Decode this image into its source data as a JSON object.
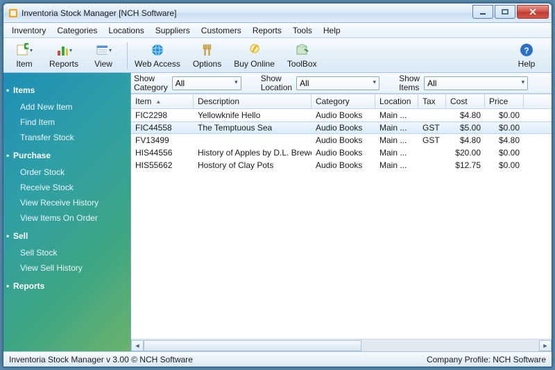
{
  "window": {
    "title": "Inventoria Stock Manager [NCH Software]"
  },
  "menubar": [
    "Inventory",
    "Categories",
    "Locations",
    "Suppliers",
    "Customers",
    "Reports",
    "Tools",
    "Help"
  ],
  "toolbar": [
    {
      "id": "item",
      "label": "Item",
      "drop": true,
      "icon": "plus"
    },
    {
      "id": "reports",
      "label": "Reports",
      "drop": true,
      "icon": "bars"
    },
    {
      "id": "view",
      "label": "View",
      "drop": true,
      "icon": "eye"
    },
    {
      "id": "sep"
    },
    {
      "id": "web",
      "label": "Web Access",
      "icon": "globe"
    },
    {
      "id": "options",
      "label": "Options",
      "icon": "wrench"
    },
    {
      "id": "buy",
      "label": "Buy Online",
      "icon": "cart"
    },
    {
      "id": "toolbox",
      "label": "ToolBox",
      "icon": "box"
    }
  ],
  "help_label": "Help",
  "filters": {
    "category_label": "Show\nCategory",
    "category_value": "All",
    "location_label": "Show\nLocation",
    "location_value": "All",
    "items_label": "Show\nItems",
    "items_value": "All"
  },
  "columns": [
    {
      "key": "item",
      "label": "Item",
      "cls": "c-item",
      "sorted": true
    },
    {
      "key": "desc",
      "label": "Description",
      "cls": "c-desc"
    },
    {
      "key": "cat",
      "label": "Category",
      "cls": "c-cat"
    },
    {
      "key": "loc",
      "label": "Location",
      "cls": "c-loc"
    },
    {
      "key": "tax",
      "label": "Tax",
      "cls": "c-tax"
    },
    {
      "key": "cost",
      "label": "Cost",
      "cls": "c-cost",
      "num": true
    },
    {
      "key": "price",
      "label": "Price",
      "cls": "c-price",
      "num": true
    }
  ],
  "rows": [
    {
      "item": "FIC2298",
      "desc": "Yellowknife Hello",
      "cat": "Audio Books",
      "loc": "Main ...",
      "tax": "",
      "cost": "$4.80",
      "price": "$0.00",
      "selected": false
    },
    {
      "item": "FIC44558",
      "desc": "The Temptuous Sea",
      "cat": "Audio Books",
      "loc": "Main ...",
      "tax": "GST",
      "cost": "$5.00",
      "price": "$0.00",
      "selected": true
    },
    {
      "item": "FV13499",
      "desc": "",
      "cat": "Audio Books",
      "loc": "Main ...",
      "tax": "GST",
      "cost": "$4.80",
      "price": "$4.80",
      "selected": false
    },
    {
      "item": "HIS44556",
      "desc": "History of Apples by D.L. Brewer",
      "cat": "Audio Books",
      "loc": "Main ...",
      "tax": "",
      "cost": "$20.00",
      "price": "$0.00",
      "selected": false
    },
    {
      "item": "HIS55662",
      "desc": "Hostory of Clay Pots",
      "cat": "Audio Books",
      "loc": "Main ...",
      "tax": "",
      "cost": "$12.75",
      "price": "$0.00",
      "selected": false
    }
  ],
  "sidebar": [
    {
      "header": "Items",
      "items": [
        "Add New Item",
        "Find Item",
        "Transfer Stock"
      ]
    },
    {
      "header": "Purchase",
      "items": [
        "Order Stock",
        "Receive Stock",
        "View Receive History",
        "View Items On Order"
      ]
    },
    {
      "header": "Sell",
      "items": [
        "Sell Stock",
        "View Sell History"
      ]
    },
    {
      "header": "Reports",
      "items": []
    }
  ],
  "status": {
    "left": "Inventoria Stock Manager v 3.00 © NCH Software",
    "right": "Company Profile: NCH Software"
  }
}
